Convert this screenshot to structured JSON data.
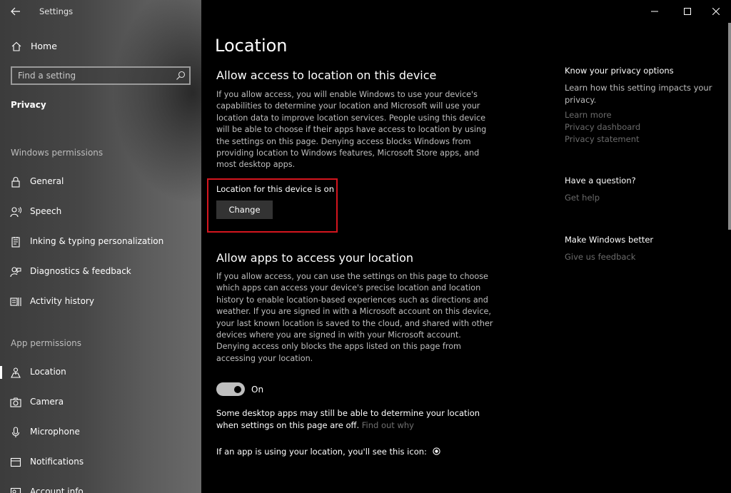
{
  "window": {
    "app_title": "Settings",
    "controls": [
      "minimize",
      "maximize",
      "close"
    ]
  },
  "sidebar": {
    "home_label": "Home",
    "search_placeholder": "Find a setting",
    "section_title": "Privacy",
    "windows_permissions_label": "Windows permissions",
    "windows_items": [
      {
        "label": "General",
        "icon": "lock-icon"
      },
      {
        "label": "Speech",
        "icon": "speech-icon"
      },
      {
        "label": "Inking & typing personalization",
        "icon": "inking-icon"
      },
      {
        "label": "Diagnostics & feedback",
        "icon": "diagnostics-icon"
      },
      {
        "label": "Activity history",
        "icon": "activity-icon"
      }
    ],
    "app_permissions_label": "App permissions",
    "app_items": [
      {
        "label": "Location",
        "icon": "location-icon",
        "selected": true
      },
      {
        "label": "Camera",
        "icon": "camera-icon"
      },
      {
        "label": "Microphone",
        "icon": "microphone-icon"
      },
      {
        "label": "Notifications",
        "icon": "notifications-icon"
      },
      {
        "label": "Account info",
        "icon": "account-icon"
      }
    ]
  },
  "main": {
    "page_title": "Location",
    "device_section": {
      "heading": "Allow access to location on this device",
      "description": "If you allow access, you will enable Windows to use your device's capabilities to determine your location and Microsoft will use your location data to improve location services. People using this device will be able to choose if their apps have access to location by using the settings on this page. Denying access blocks Windows from providing location to Windows features, Microsoft Store apps, and most desktop apps.",
      "status": "Location for this device is on",
      "change_label": "Change"
    },
    "apps_section": {
      "heading": "Allow apps to access your location",
      "description": "If you allow access, you can use the settings on this page to choose which apps can access your device's precise location and location history to enable location-based experiences such as directions and weather. If you are signed in with a Microsoft account on this device, your last known location is saved to the cloud, and shared with other devices where you are signed in with your Microsoft account. Denying access only blocks the apps listed on this page from accessing your location.",
      "toggle_state": "On",
      "toggle_on": true,
      "note": "Some desktop apps may still be able to determine your location when settings on this page are off.",
      "note_link": "Find out why",
      "icon_note": "If an app is using your location, you'll see this icon:"
    }
  },
  "right_column": {
    "privacy_heading": "Know your privacy options",
    "privacy_text": "Learn how this setting impacts your privacy.",
    "privacy_links": [
      "Learn more",
      "Privacy dashboard",
      "Privacy statement"
    ],
    "question_heading": "Have a question?",
    "question_link": "Get help",
    "better_heading": "Make Windows better",
    "better_link": "Give us feedback"
  },
  "colors": {
    "highlight": "#d4151e",
    "background": "#000000",
    "muted_link": "#6b6b6b"
  }
}
